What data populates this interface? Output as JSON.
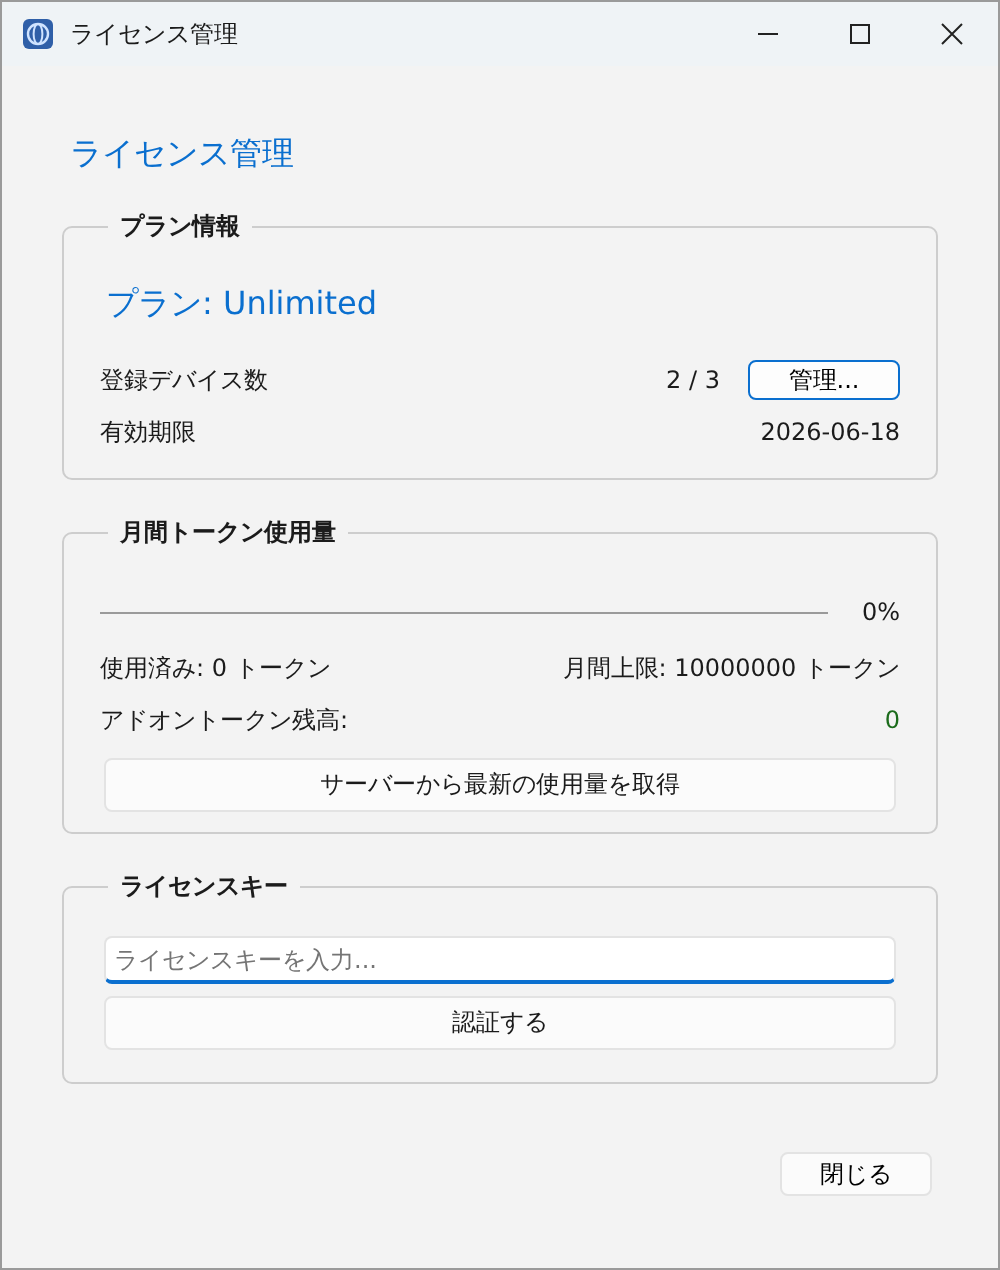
{
  "window": {
    "title": "ライセンス管理"
  },
  "heading": "ライセンス管理",
  "plan_info": {
    "title": "プラン情報",
    "plan": "プラン: Unlimited",
    "rows": [
      {
        "label": "登録デバイス数",
        "value": "2 / 3",
        "button": "管理..."
      },
      {
        "label": "有効期限",
        "value": "2026-06-18"
      }
    ]
  },
  "usage": {
    "title": "月間トークン使用量",
    "level": 0,
    "percent": "0%",
    "used": "使用済み: 0 トークン",
    "limit": "月間上限: 10000000 トークン",
    "addon_label": "アドオントークン残高:",
    "addon_value": "0",
    "refresh_button": "サーバーから最新の使用量を取得"
  },
  "license_key": {
    "title": "ライセンスキー",
    "placeholder": "ライセンスキーを入力...",
    "verify_button": "認証する"
  },
  "close_button": "閉じる"
}
